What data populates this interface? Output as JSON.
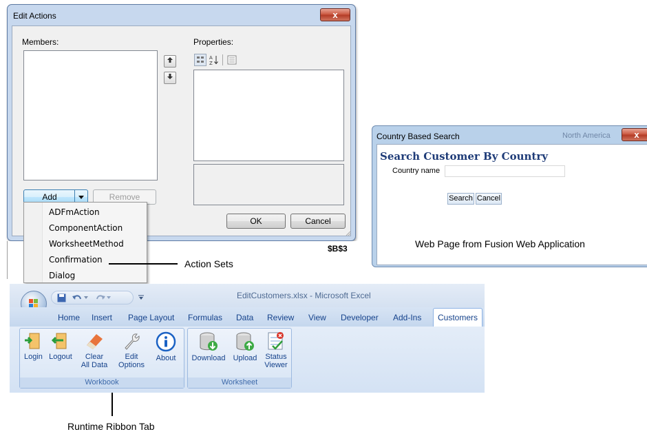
{
  "edit_actions": {
    "title": "Edit Actions",
    "close_glyph": "x",
    "members_label": "Members:",
    "properties_label": "Properties:",
    "add_label": "Add",
    "remove_label": "Remove",
    "ok_label": "OK",
    "cancel_label": "Cancel",
    "behind_cell": "$B$3",
    "menu_items": [
      "ADFmAction",
      "ComponentAction",
      "WorksheetMethod",
      "Confirmation",
      "Dialog"
    ]
  },
  "annotations": {
    "action_sets": "Action Sets",
    "web_page": "Web Page from Fusion Web Application",
    "runtime_ribbon": "Runtime Ribbon Tab"
  },
  "country_search": {
    "title": "Country Based Search",
    "heading": "Search Customer By Country",
    "field_label": "Country name",
    "field_value": "",
    "search_label": "Search",
    "cancel_label": "Cancel",
    "behind_text": "North America",
    "close_glyph": "x"
  },
  "excel": {
    "window_title": "EditCustomers.xlsx - Microsoft Excel",
    "tabs": [
      "Home",
      "Insert",
      "Page Layout",
      "Formulas",
      "Data",
      "Review",
      "View",
      "Developer",
      "Add-Ins",
      "Customers"
    ],
    "workbook_group": "Workbook",
    "worksheet_group": "Worksheet",
    "buttons": {
      "login": "Login",
      "logout": "Logout",
      "clear_1": "Clear",
      "clear_2": "All Data",
      "edit_1": "Edit",
      "edit_2": "Options",
      "about": "About",
      "download": "Download",
      "upload": "Upload",
      "status_1": "Status",
      "status_2": "Viewer"
    }
  },
  "colors": {
    "dialog_frame": "#c7d8ee",
    "close_red": "#c9543c",
    "ribbon_text": "#15428b",
    "heading_blue": "#1f3c78"
  }
}
